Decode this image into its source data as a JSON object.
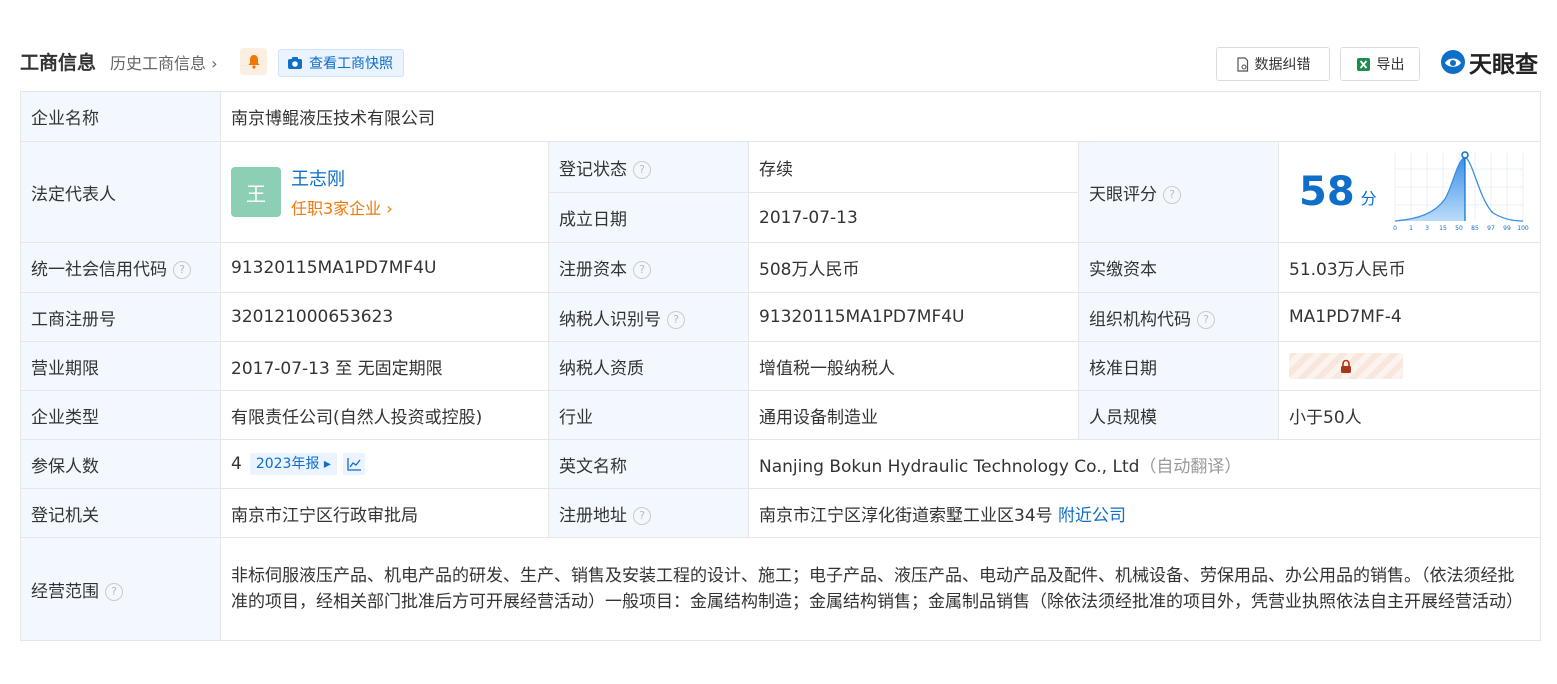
{
  "header": {
    "title": "工商信息",
    "history": "历史工商信息",
    "snapshot_label": "查看工商快照",
    "correct_label": "数据纠错",
    "export_label": "导出",
    "logo_text": "天眼查"
  },
  "company_name": {
    "label": "企业名称",
    "value": "南京博鲲液压技术有限公司"
  },
  "legal_rep": {
    "label": "法定代表人",
    "avatar": "王",
    "name": "王志刚",
    "positions": "任职3家企业"
  },
  "reg_status": {
    "label": "登记状态",
    "value": "存续"
  },
  "est_date": {
    "label": "成立日期",
    "value": "2017-07-13"
  },
  "tianyan_score": {
    "label": "天眼评分",
    "value": "58",
    "unit": "分",
    "axis": [
      "0",
      "1",
      "3",
      "15",
      "50",
      "85",
      "97",
      "99",
      "100"
    ]
  },
  "credit_code": {
    "label": "统一社会信用代码",
    "value": "91320115MA1PD7MF4U"
  },
  "reg_capital": {
    "label": "注册资本",
    "value": "508万人民币"
  },
  "paid_capital": {
    "label": "实缴资本",
    "value": "51.03万人民币"
  },
  "reg_number": {
    "label": "工商注册号",
    "value": "320121000653623"
  },
  "taxpayer_id": {
    "label": "纳税人识别号",
    "value": "91320115MA1PD7MF4U"
  },
  "org_code": {
    "label": "组织机构代码",
    "value": "MA1PD7MF-4"
  },
  "business_term": {
    "label": "营业期限",
    "value": "2017-07-13 至 无固定期限"
  },
  "taxpayer_type": {
    "label": "纳税人资质",
    "value": "增值税一般纳税人"
  },
  "approval_date": {
    "label": "核准日期"
  },
  "company_type": {
    "label": "企业类型",
    "value": "有限责任公司(自然人投资或控股)"
  },
  "industry": {
    "label": "行业",
    "value": "通用设备制造业"
  },
  "staff_size": {
    "label": "人员规模",
    "value": "小于50人"
  },
  "insured": {
    "label": "参保人数",
    "value": "4",
    "report": "2023年报"
  },
  "english_name": {
    "label": "英文名称",
    "value": "Nanjing Bokun Hydraulic Technology Co., Ltd",
    "note": "（自动翻译）"
  },
  "reg_authority": {
    "label": "登记机关",
    "value": "南京市江宁区行政审批局"
  },
  "reg_address": {
    "label": "注册地址",
    "value": "南京市江宁区淳化街道索墅工业区34号",
    "nearby": "附近公司"
  },
  "business_scope": {
    "label": "经营范围",
    "value": "非标伺服液压产品、机电产品的研发、生产、销售及安装工程的设计、施工；电子产品、液压产品、电动产品及配件、机械设备、劳保用品、办公用品的销售。（依法须经批准的项目，经相关部门批准后方可开展经营活动）一般项目：金属结构制造；金属结构销售；金属制品销售（除依法须经批准的项目外，凭营业执照依法自主开展经营活动）"
  }
}
